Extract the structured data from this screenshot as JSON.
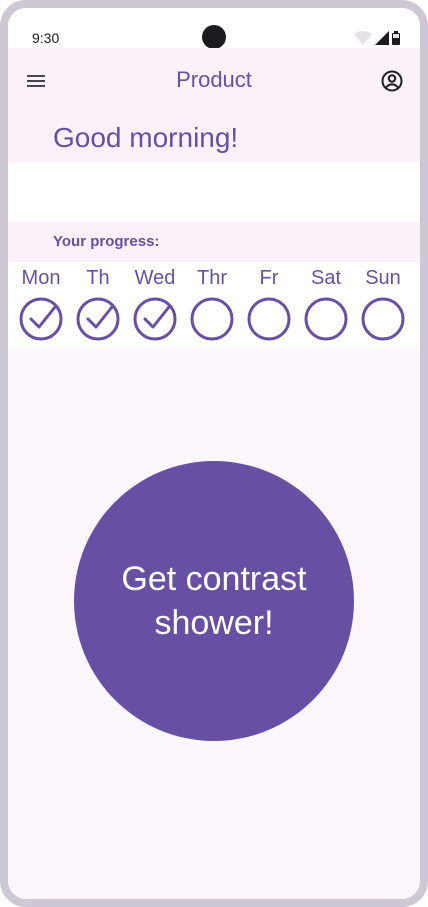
{
  "status_bar": {
    "time": "9:30",
    "icons": [
      "wifi-icon",
      "cellular-signal-icon",
      "battery-icon"
    ]
  },
  "app_bar": {
    "title": "Product",
    "left_icon": "menu-icon",
    "right_icon": "account-circle-icon"
  },
  "greeting": "Good morning!",
  "progress": {
    "label": "Your progress:",
    "days": [
      {
        "label": "Mon",
        "done": true
      },
      {
        "label": "Th",
        "done": true
      },
      {
        "label": "Wed",
        "done": true
      },
      {
        "label": "Thr",
        "done": false
      },
      {
        "label": "Fr",
        "done": false
      },
      {
        "label": "Sat",
        "done": false
      },
      {
        "label": "Sun",
        "done": false
      }
    ]
  },
  "cta": {
    "label": "Get contrast shower!"
  },
  "colors": {
    "primary": "#6750a4",
    "surface": "#fdf6fc",
    "surface_container": "#fbf1fb",
    "frame": "#cdc8d3"
  }
}
